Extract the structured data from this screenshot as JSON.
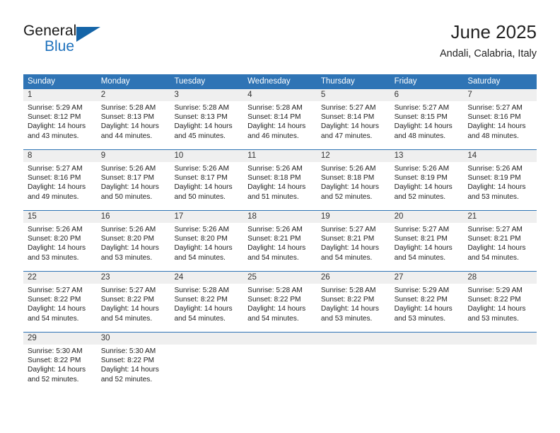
{
  "logo": {
    "word_one": "General",
    "word_two": "Blue",
    "triangle_icon": "triangle-icon",
    "brand_color": "#1f72bd"
  },
  "header": {
    "title": "June 2025",
    "subtitle": "Andali, Calabria, Italy",
    "header_bg": "#2f74b5",
    "band_bg": "#efefef"
  },
  "weekdays": [
    "Sunday",
    "Monday",
    "Tuesday",
    "Wednesday",
    "Thursday",
    "Friday",
    "Saturday"
  ],
  "weeks": [
    {
      "days": [
        {
          "num": "1",
          "sunrise": "Sunrise: 5:29 AM",
          "sunset": "Sunset: 8:12 PM",
          "daylight1": "Daylight: 14 hours",
          "daylight2": "and 43 minutes."
        },
        {
          "num": "2",
          "sunrise": "Sunrise: 5:28 AM",
          "sunset": "Sunset: 8:13 PM",
          "daylight1": "Daylight: 14 hours",
          "daylight2": "and 44 minutes."
        },
        {
          "num": "3",
          "sunrise": "Sunrise: 5:28 AM",
          "sunset": "Sunset: 8:13 PM",
          "daylight1": "Daylight: 14 hours",
          "daylight2": "and 45 minutes."
        },
        {
          "num": "4",
          "sunrise": "Sunrise: 5:28 AM",
          "sunset": "Sunset: 8:14 PM",
          "daylight1": "Daylight: 14 hours",
          "daylight2": "and 46 minutes."
        },
        {
          "num": "5",
          "sunrise": "Sunrise: 5:27 AM",
          "sunset": "Sunset: 8:14 PM",
          "daylight1": "Daylight: 14 hours",
          "daylight2": "and 47 minutes."
        },
        {
          "num": "6",
          "sunrise": "Sunrise: 5:27 AM",
          "sunset": "Sunset: 8:15 PM",
          "daylight1": "Daylight: 14 hours",
          "daylight2": "and 48 minutes."
        },
        {
          "num": "7",
          "sunrise": "Sunrise: 5:27 AM",
          "sunset": "Sunset: 8:16 PM",
          "daylight1": "Daylight: 14 hours",
          "daylight2": "and 48 minutes."
        }
      ]
    },
    {
      "days": [
        {
          "num": "8",
          "sunrise": "Sunrise: 5:27 AM",
          "sunset": "Sunset: 8:16 PM",
          "daylight1": "Daylight: 14 hours",
          "daylight2": "and 49 minutes."
        },
        {
          "num": "9",
          "sunrise": "Sunrise: 5:26 AM",
          "sunset": "Sunset: 8:17 PM",
          "daylight1": "Daylight: 14 hours",
          "daylight2": "and 50 minutes."
        },
        {
          "num": "10",
          "sunrise": "Sunrise: 5:26 AM",
          "sunset": "Sunset: 8:17 PM",
          "daylight1": "Daylight: 14 hours",
          "daylight2": "and 50 minutes."
        },
        {
          "num": "11",
          "sunrise": "Sunrise: 5:26 AM",
          "sunset": "Sunset: 8:18 PM",
          "daylight1": "Daylight: 14 hours",
          "daylight2": "and 51 minutes."
        },
        {
          "num": "12",
          "sunrise": "Sunrise: 5:26 AM",
          "sunset": "Sunset: 8:18 PM",
          "daylight1": "Daylight: 14 hours",
          "daylight2": "and 52 minutes."
        },
        {
          "num": "13",
          "sunrise": "Sunrise: 5:26 AM",
          "sunset": "Sunset: 8:19 PM",
          "daylight1": "Daylight: 14 hours",
          "daylight2": "and 52 minutes."
        },
        {
          "num": "14",
          "sunrise": "Sunrise: 5:26 AM",
          "sunset": "Sunset: 8:19 PM",
          "daylight1": "Daylight: 14 hours",
          "daylight2": "and 53 minutes."
        }
      ]
    },
    {
      "days": [
        {
          "num": "15",
          "sunrise": "Sunrise: 5:26 AM",
          "sunset": "Sunset: 8:20 PM",
          "daylight1": "Daylight: 14 hours",
          "daylight2": "and 53 minutes."
        },
        {
          "num": "16",
          "sunrise": "Sunrise: 5:26 AM",
          "sunset": "Sunset: 8:20 PM",
          "daylight1": "Daylight: 14 hours",
          "daylight2": "and 53 minutes."
        },
        {
          "num": "17",
          "sunrise": "Sunrise: 5:26 AM",
          "sunset": "Sunset: 8:20 PM",
          "daylight1": "Daylight: 14 hours",
          "daylight2": "and 54 minutes."
        },
        {
          "num": "18",
          "sunrise": "Sunrise: 5:26 AM",
          "sunset": "Sunset: 8:21 PM",
          "daylight1": "Daylight: 14 hours",
          "daylight2": "and 54 minutes."
        },
        {
          "num": "19",
          "sunrise": "Sunrise: 5:27 AM",
          "sunset": "Sunset: 8:21 PM",
          "daylight1": "Daylight: 14 hours",
          "daylight2": "and 54 minutes."
        },
        {
          "num": "20",
          "sunrise": "Sunrise: 5:27 AM",
          "sunset": "Sunset: 8:21 PM",
          "daylight1": "Daylight: 14 hours",
          "daylight2": "and 54 minutes."
        },
        {
          "num": "21",
          "sunrise": "Sunrise: 5:27 AM",
          "sunset": "Sunset: 8:21 PM",
          "daylight1": "Daylight: 14 hours",
          "daylight2": "and 54 minutes."
        }
      ]
    },
    {
      "days": [
        {
          "num": "22",
          "sunrise": "Sunrise: 5:27 AM",
          "sunset": "Sunset: 8:22 PM",
          "daylight1": "Daylight: 14 hours",
          "daylight2": "and 54 minutes."
        },
        {
          "num": "23",
          "sunrise": "Sunrise: 5:27 AM",
          "sunset": "Sunset: 8:22 PM",
          "daylight1": "Daylight: 14 hours",
          "daylight2": "and 54 minutes."
        },
        {
          "num": "24",
          "sunrise": "Sunrise: 5:28 AM",
          "sunset": "Sunset: 8:22 PM",
          "daylight1": "Daylight: 14 hours",
          "daylight2": "and 54 minutes."
        },
        {
          "num": "25",
          "sunrise": "Sunrise: 5:28 AM",
          "sunset": "Sunset: 8:22 PM",
          "daylight1": "Daylight: 14 hours",
          "daylight2": "and 54 minutes."
        },
        {
          "num": "26",
          "sunrise": "Sunrise: 5:28 AM",
          "sunset": "Sunset: 8:22 PM",
          "daylight1": "Daylight: 14 hours",
          "daylight2": "and 53 minutes."
        },
        {
          "num": "27",
          "sunrise": "Sunrise: 5:29 AM",
          "sunset": "Sunset: 8:22 PM",
          "daylight1": "Daylight: 14 hours",
          "daylight2": "and 53 minutes."
        },
        {
          "num": "28",
          "sunrise": "Sunrise: 5:29 AM",
          "sunset": "Sunset: 8:22 PM",
          "daylight1": "Daylight: 14 hours",
          "daylight2": "and 53 minutes."
        }
      ]
    },
    {
      "days": [
        {
          "num": "29",
          "sunrise": "Sunrise: 5:30 AM",
          "sunset": "Sunset: 8:22 PM",
          "daylight1": "Daylight: 14 hours",
          "daylight2": "and 52 minutes."
        },
        {
          "num": "30",
          "sunrise": "Sunrise: 5:30 AM",
          "sunset": "Sunset: 8:22 PM",
          "daylight1": "Daylight: 14 hours",
          "daylight2": "and 52 minutes."
        },
        {
          "num": "",
          "sunrise": "",
          "sunset": "",
          "daylight1": "",
          "daylight2": ""
        },
        {
          "num": "",
          "sunrise": "",
          "sunset": "",
          "daylight1": "",
          "daylight2": ""
        },
        {
          "num": "",
          "sunrise": "",
          "sunset": "",
          "daylight1": "",
          "daylight2": ""
        },
        {
          "num": "",
          "sunrise": "",
          "sunset": "",
          "daylight1": "",
          "daylight2": ""
        },
        {
          "num": "",
          "sunrise": "",
          "sunset": "",
          "daylight1": "",
          "daylight2": ""
        }
      ]
    }
  ]
}
